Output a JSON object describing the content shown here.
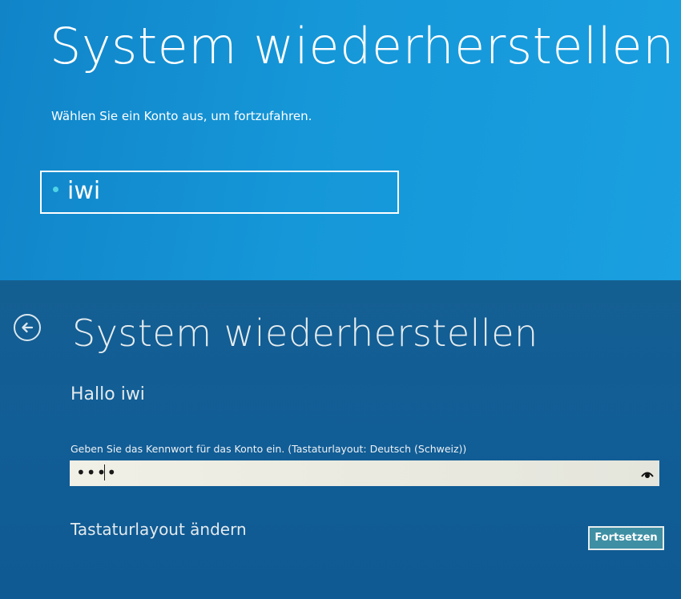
{
  "account_screen": {
    "title": "System wiederherstellen",
    "subtitle": "Wählen Sie ein Konto aus, um fortzufahren.",
    "accounts": [
      {
        "name": "iwi"
      }
    ]
  },
  "password_screen": {
    "title": "System wiederherstellen",
    "greeting": "Hallo iwi",
    "prompt": "Geben Sie das Kennwort für das Konto ein. (Tastaturlayout: Deutsch (Schweiz))",
    "password_mask": "••••",
    "change_layout_label": "Tastaturlayout ändern",
    "continue_label": "Fortsetzen"
  },
  "icons": {
    "back": "back-arrow-icon",
    "reveal": "eye-icon"
  },
  "colors": {
    "top_background": "#1597d8",
    "bottom_background": "#115d96",
    "account_dot": "#4fd3e6",
    "continue_button": "#3f8fa4"
  }
}
